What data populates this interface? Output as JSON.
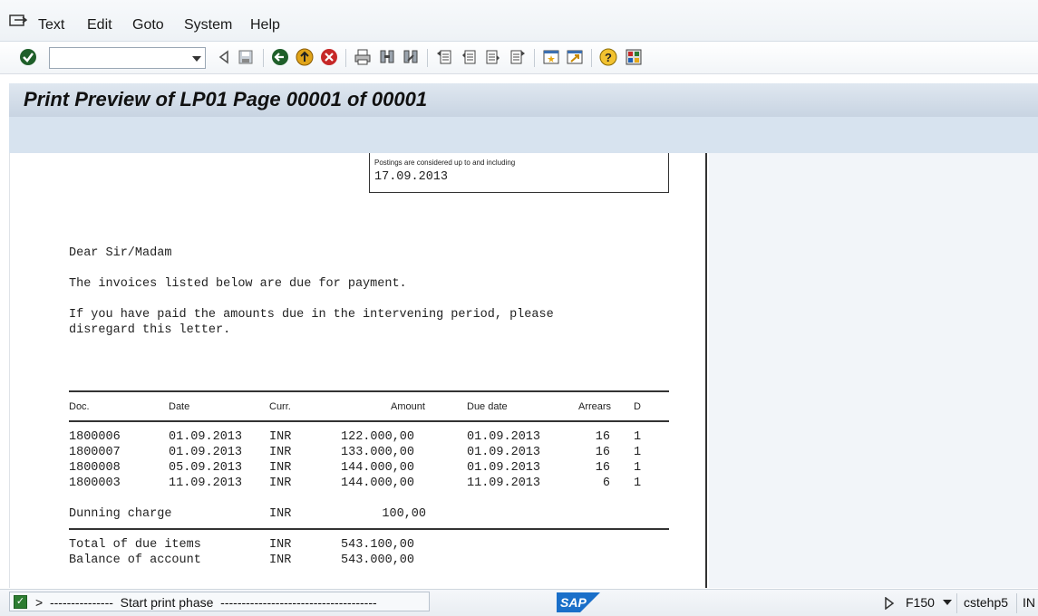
{
  "menu": {
    "items": [
      "Text",
      "Edit",
      "Goto",
      "System",
      "Help"
    ]
  },
  "toolbar": {
    "command_field_value": "",
    "icons": [
      "enter-icon",
      "back-icon",
      "save-icon",
      "back-green-icon",
      "exit-icon",
      "cancel-icon",
      "print-icon",
      "find-icon",
      "find-next-icon",
      "first-page-icon",
      "previous-page-icon",
      "next-page-icon",
      "last-page-icon",
      "create-session-icon",
      "shortcut-icon",
      "help-icon",
      "customize-layout-icon"
    ]
  },
  "title": {
    "text": "Print Preview of LP01 Page 00001 of 00001"
  },
  "document": {
    "postings_label": "Postings  are  considered  up  to and   including",
    "postings_date": "17.09.2013",
    "salutation": "Dear Sir/Madam",
    "line1": "The invoices listed below are due for payment.",
    "line2a": "If you have paid the amounts due in the intervening period, please",
    "line2b": "disregard this letter.",
    "columns": {
      "doc": "Doc.",
      "date": "Date",
      "curr": "Curr.",
      "amount": "Amount",
      "due_date": "Due  date",
      "arrears": "Arrears",
      "d": "D"
    },
    "rows": [
      {
        "doc": "1800006",
        "date": "01.09.2013",
        "curr": "INR",
        "amount": "122.000,00",
        "due": "01.09.2013",
        "arrears": "16",
        "d": "1"
      },
      {
        "doc": "1800007",
        "date": "01.09.2013",
        "curr": "INR",
        "amount": "133.000,00",
        "due": "01.09.2013",
        "arrears": "16",
        "d": "1"
      },
      {
        "doc": "1800008",
        "date": "05.09.2013",
        "curr": "INR",
        "amount": "144.000,00",
        "due": "01.09.2013",
        "arrears": "16",
        "d": "1"
      },
      {
        "doc": "1800003",
        "date": "11.09.2013",
        "curr": "INR",
        "amount": "144.000,00",
        "due": "11.09.2013",
        "arrears": "6",
        "d": "1"
      }
    ],
    "dunning_label": "Dunning charge",
    "dunning_curr": "INR",
    "dunning_amount": "100,00",
    "total_label": "Total of due items",
    "total_curr": "INR",
    "total_amount": "543.100,00",
    "balance_label": "Balance of account",
    "balance_curr": "INR",
    "balance_amount": "543.000,00"
  },
  "status": {
    "message": ">  ---------------  Start print phase  -------------------------------------",
    "logo": "SAP",
    "transaction": "F150",
    "server": "cstehp5",
    "mode": "IN"
  },
  "colors": {
    "titlebar": "#c8d4e2",
    "appbar": "#d7e3ef",
    "ok_green": "#2e7d32"
  }
}
